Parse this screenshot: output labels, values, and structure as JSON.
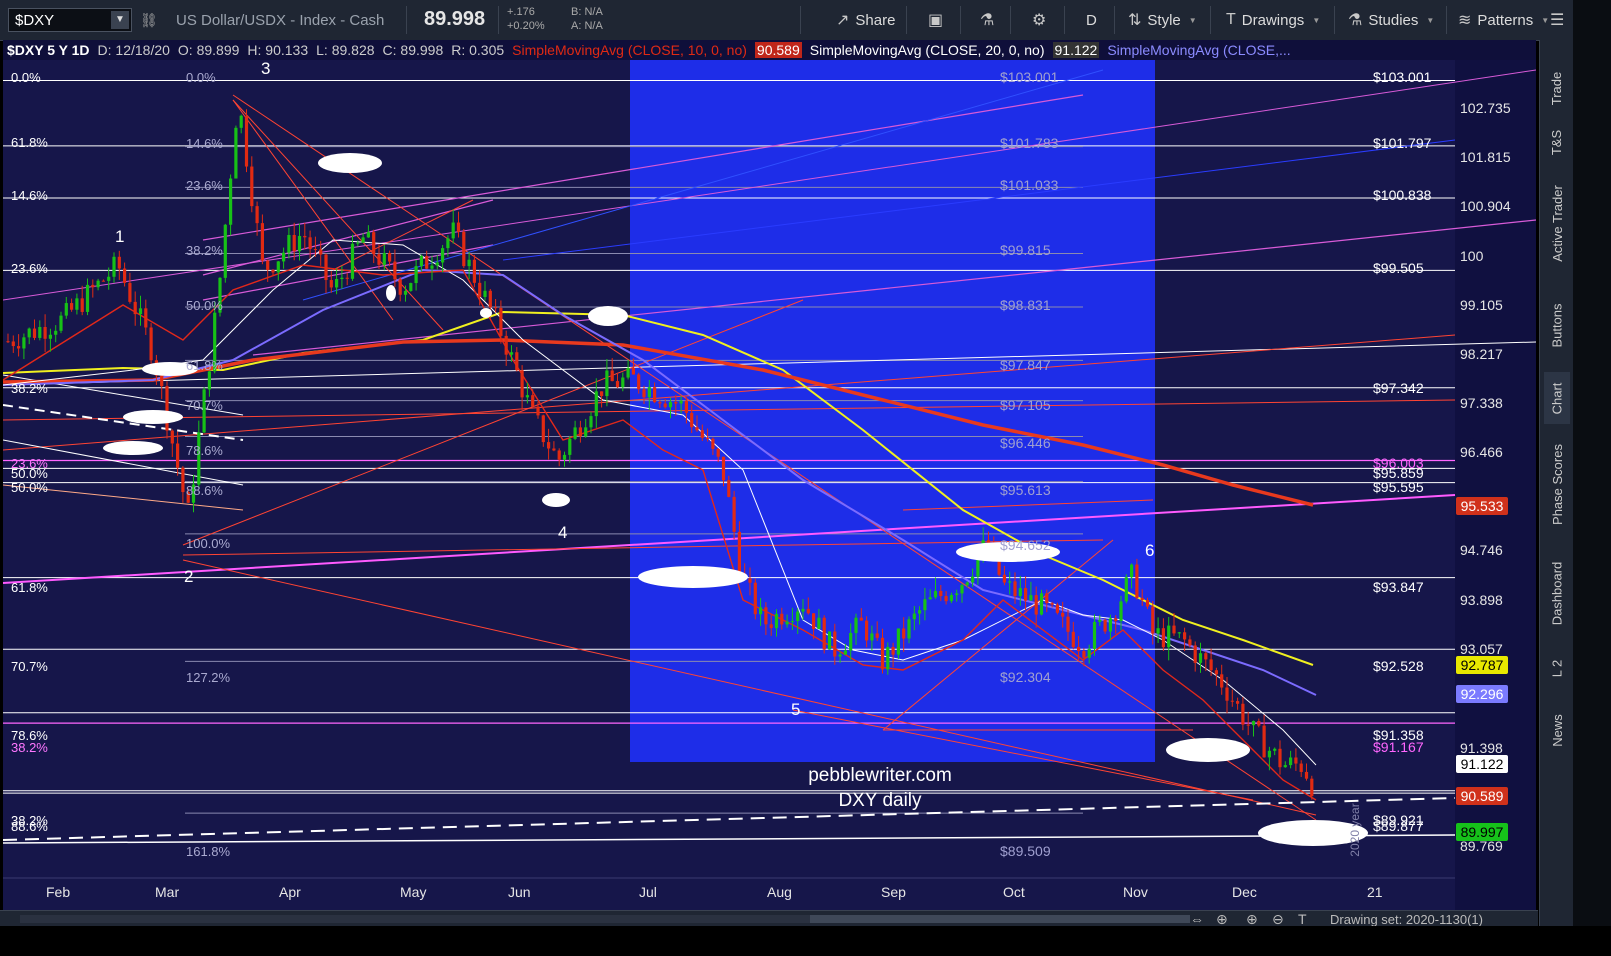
{
  "toolbar": {
    "symbol": "$DXY",
    "description": "US Dollar/USDX - Index - Cash",
    "last": "89.998",
    "change": "+.176",
    "change_pct": "+0.20%",
    "bid": "B: N/A",
    "ask": "A: N/A",
    "share_label": "Share",
    "aggregation": "D",
    "style_label": "Style",
    "drawings_label": "Drawings",
    "studies_label": "Studies",
    "patterns_label": "Patterns"
  },
  "studyline": {
    "spec": "$DXY 5 Y 1D",
    "date": "D: 12/18/20",
    "open": "O: 89.899",
    "high": "H: 90.133",
    "low": "L: 89.828",
    "close": "C: 89.998",
    "range": "R: 0.305",
    "sma10": "SimpleMovingAvg (CLOSE, 10, 0, no)",
    "sma10_val": "90.589",
    "sma20": "SimpleMovingAvg (CLOSE, 20, 0, no)",
    "sma20_val": "91.122",
    "sma50": "SimpleMovingAvg (CLOSE,..."
  },
  "side_tabs": [
    "Trade",
    "T&S",
    "Active Trader",
    "Buttons",
    "Chart",
    "Phase Scores",
    "Dashboard",
    "L 2",
    "News"
  ],
  "bottom": {
    "drawing_set": "Drawing set: 2020-1130(1)"
  },
  "chart": {
    "watermark_1": "pebblewriter.com",
    "watermark_2": "DXY daily",
    "year_label": "2020 year",
    "x_ticks": [
      "Feb",
      "Mar",
      "Apr",
      "May",
      "Jun",
      "Jul",
      "Aug",
      "Sep",
      "Oct",
      "Nov",
      "Dec",
      "21"
    ],
    "y_ticks": [
      "102.735",
      "101.815",
      "100.904",
      "100",
      "99.105",
      "98.217",
      "97.338",
      "96.466",
      "94.746",
      "93.898",
      "93.057",
      "91.398",
      "89.769"
    ],
    "wave_labels": [
      "1",
      "2",
      "3",
      "4",
      "5",
      "6"
    ],
    "left_fib_labels": [
      "0.0%",
      "61.8%",
      "14.6%",
      "23.6%",
      "38.2%",
      "23.6%",
      "50.0%",
      "50.0%",
      "61.8%",
      "70.7%",
      "78.6%",
      "38.2%",
      "38.2%",
      "88.6%"
    ],
    "mid_fib_labels": [
      "0.0%",
      "14.6%",
      "23.6%",
      "38.2%",
      "50.0%",
      "61.8%",
      "70.7%",
      "78.6%",
      "88.6%",
      "100.0%",
      "127.2%",
      "161.8%"
    ],
    "mid_price_labels": [
      "$103.001",
      "$101.783",
      "$101.033",
      "$99.815",
      "$98.831",
      "$97.847",
      "$97.105",
      "$96.446",
      "$95.613",
      "$94.652",
      "$92.304",
      "$89.509"
    ],
    "right_price_labels": [
      "$103.001",
      "$101.797",
      "$100.838",
      "$99.505",
      "$97.342",
      "$96.003",
      "$95.859",
      "$95.595",
      "$93.847",
      "$92.528",
      "$91.358",
      "$91.167",
      "$89.921",
      "$89.877"
    ],
    "badges": [
      {
        "text": "95.533",
        "bg": "#d0311b",
        "fg": "#ffffff"
      },
      {
        "text": "92.787",
        "bg": "#e8e800",
        "fg": "#000000"
      },
      {
        "text": "92.296",
        "bg": "#7b7bff",
        "fg": "#ffffff"
      },
      {
        "text": "91.122",
        "bg": "#ffffff",
        "fg": "#000000"
      },
      {
        "text": "90.589",
        "bg": "#d0311b",
        "fg": "#ffffff"
      },
      {
        "text": "89.997",
        "bg": "#16c21a",
        "fg": "#000000"
      }
    ],
    "colors": {
      "bg": "#16164a",
      "highlight": "#1e2de8",
      "up": "#17c117",
      "down": "#e22a12"
    }
  }
}
